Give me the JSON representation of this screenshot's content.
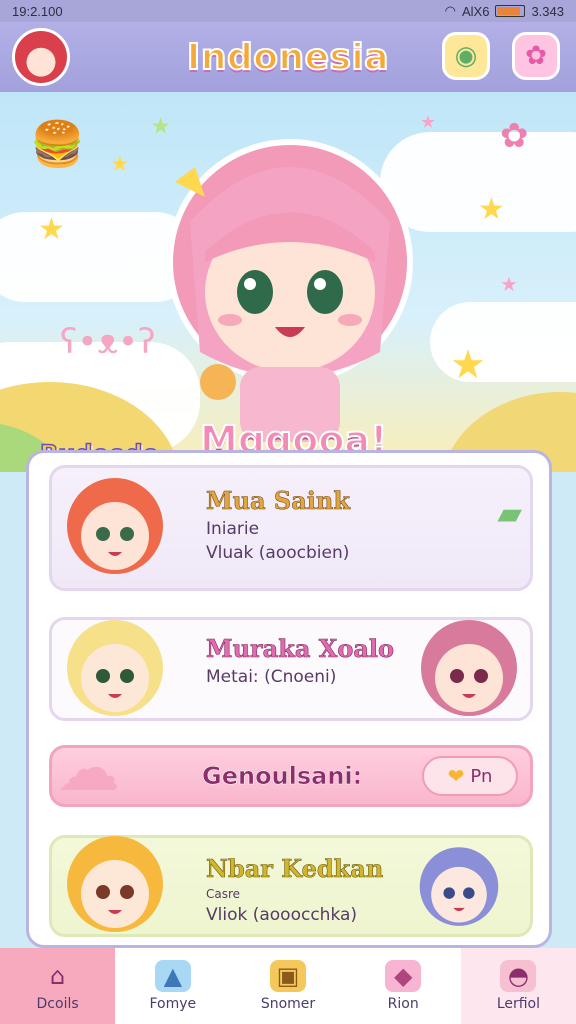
{
  "status": {
    "time": "19:2.100",
    "right_text": "3.343",
    "signal_text": "AlX6"
  },
  "header": {
    "title": "Indonesia"
  },
  "labels": {
    "left": "Budeode",
    "center": "Mggooa!"
  },
  "cards": [
    {
      "name": "Mua Saink",
      "line1": "Iniarie",
      "line2": "Vluak (aoocbien)"
    },
    {
      "name": "Muraka Xoalo",
      "line1": "Metai: (Cnoeni)"
    },
    {
      "banner": "Genoulsani:",
      "button": "Pn"
    },
    {
      "name": "Nbar Kedkan",
      "line1": "Casre",
      "line2": "Vliok (aooocchka)"
    }
  ],
  "nav": [
    {
      "label": "Dcoils",
      "icon": "home-icon"
    },
    {
      "label": "Fomye",
      "icon": "slide-icon"
    },
    {
      "label": "Snomer",
      "icon": "box-icon"
    },
    {
      "label": "Rion",
      "icon": "cake-icon"
    },
    {
      "label": "Lerfiol",
      "icon": "ufo-icon"
    }
  ],
  "colors": {
    "header": "#a3a1dc",
    "title": "#f4a93a",
    "panel_border": "#b8b5e2",
    "nav_active": "#f7a9bd"
  }
}
